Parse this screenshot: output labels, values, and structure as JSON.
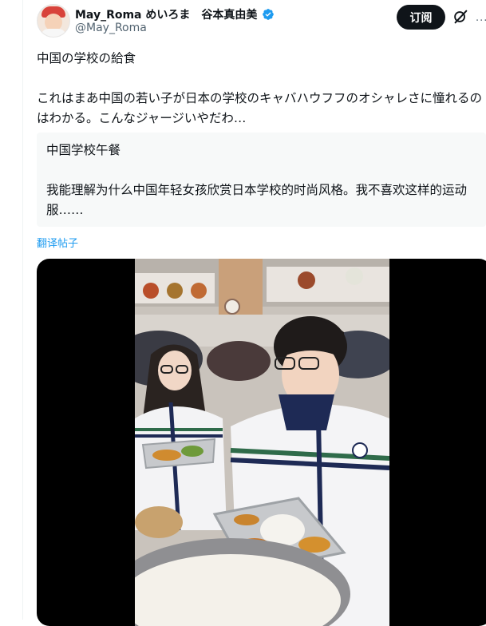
{
  "author": {
    "display_name": "May_Roma めいろま　谷本真由美",
    "handle": "@May_Roma"
  },
  "actions": {
    "subscribe_label": "订阅",
    "grok_icon": "grok-icon",
    "more_icon": "more-icon"
  },
  "tweet": {
    "line1": "中国の学校の給食",
    "line2": "これはまあ中国の若い子が日本の学校のキャバハウフフのオシャレさに憧れるのはわかる。こんなジャージいやだわ…"
  },
  "translation": {
    "line1": "中国学校午餐",
    "line2": "我能理解为什么中国年轻女孩欣赏日本学校的时尚风格。我不喜欢这样的运动服……"
  },
  "translate_link": "翻译帖子",
  "colors": {
    "accent": "#1d9bf0",
    "text": "#0f1419",
    "secondary": "#536471",
    "button": "#0f1419"
  }
}
